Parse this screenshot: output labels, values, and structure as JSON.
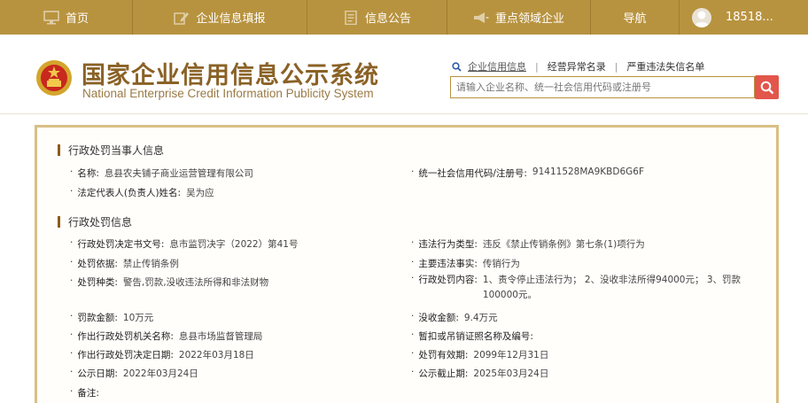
{
  "nav": {
    "items": [
      {
        "label": "首页",
        "icon": "monitor-icon"
      },
      {
        "label": "企业信息填报",
        "icon": "edit-icon"
      },
      {
        "label": "信息公告",
        "icon": "document-icon"
      },
      {
        "label": "重点领域企业",
        "icon": "megaphone-icon"
      },
      {
        "label": "导航",
        "icon": ""
      }
    ],
    "user": "18518..."
  },
  "header": {
    "title": "国家企业信用信息公示系统",
    "subtitle": "National Enterprise Credit Information Publicity System",
    "tabs": [
      "企业信用信息",
      "经营异常名录",
      "严重违法失信名单"
    ],
    "search_placeholder": "请输入企业名称、统一社会信用代码或注册号"
  },
  "party": {
    "section_title": "行政处罚当事人信息",
    "name_label": "名称:",
    "name": "息县农夫铺子商业运营管理有限公司",
    "code_label": "统一社会信用代码/注册号:",
    "code": "91411528MA9KBD6G6F",
    "rep_label": "法定代表人(负责人)姓名:",
    "rep": "吴为应"
  },
  "penalty": {
    "section_title": "行政处罚信息",
    "rows": [
      {
        "label": "行政处罚决定书文号:",
        "value": "息市监罚决字（2022）第41号"
      },
      {
        "label": "违法行为类型:",
        "value": "违反《禁止传销条例》第七条(1)项行为"
      },
      {
        "label": "处罚依据:",
        "value": "禁止传销条例"
      },
      {
        "label": "主要违法事实:",
        "value": "传销行为"
      },
      {
        "label": "处罚种类:",
        "value": "警告,罚款,没收违法所得和非法财物"
      },
      {
        "label": "行政处罚内容:",
        "value": "1、责令停止违法行为； 2、没收非法所得94000元； 3、罚款100000元。"
      },
      {
        "label": "罚款金额:",
        "value": "10万元"
      },
      {
        "label": "没收金额:",
        "value": "9.4万元"
      },
      {
        "label": "作出行政处罚机关名称:",
        "value": "息县市场监督管理局"
      },
      {
        "label": "暂扣或吊销证照名称及编号:",
        "value": ""
      },
      {
        "label": "作出行政处罚决定日期:",
        "value": "2022年03月18日"
      },
      {
        "label": "处罚有效期:",
        "value": "2099年12月31日"
      },
      {
        "label": "公示日期:",
        "value": "2022年03月24日"
      },
      {
        "label": "公示截止期:",
        "value": "2025年03月24日"
      },
      {
        "label": "备注:",
        "value": ""
      }
    ]
  },
  "colors": {
    "nav_bg": "#b8933f",
    "title": "#8a6226",
    "search_button": "#e2564b",
    "card_border": "#d9bf85"
  }
}
